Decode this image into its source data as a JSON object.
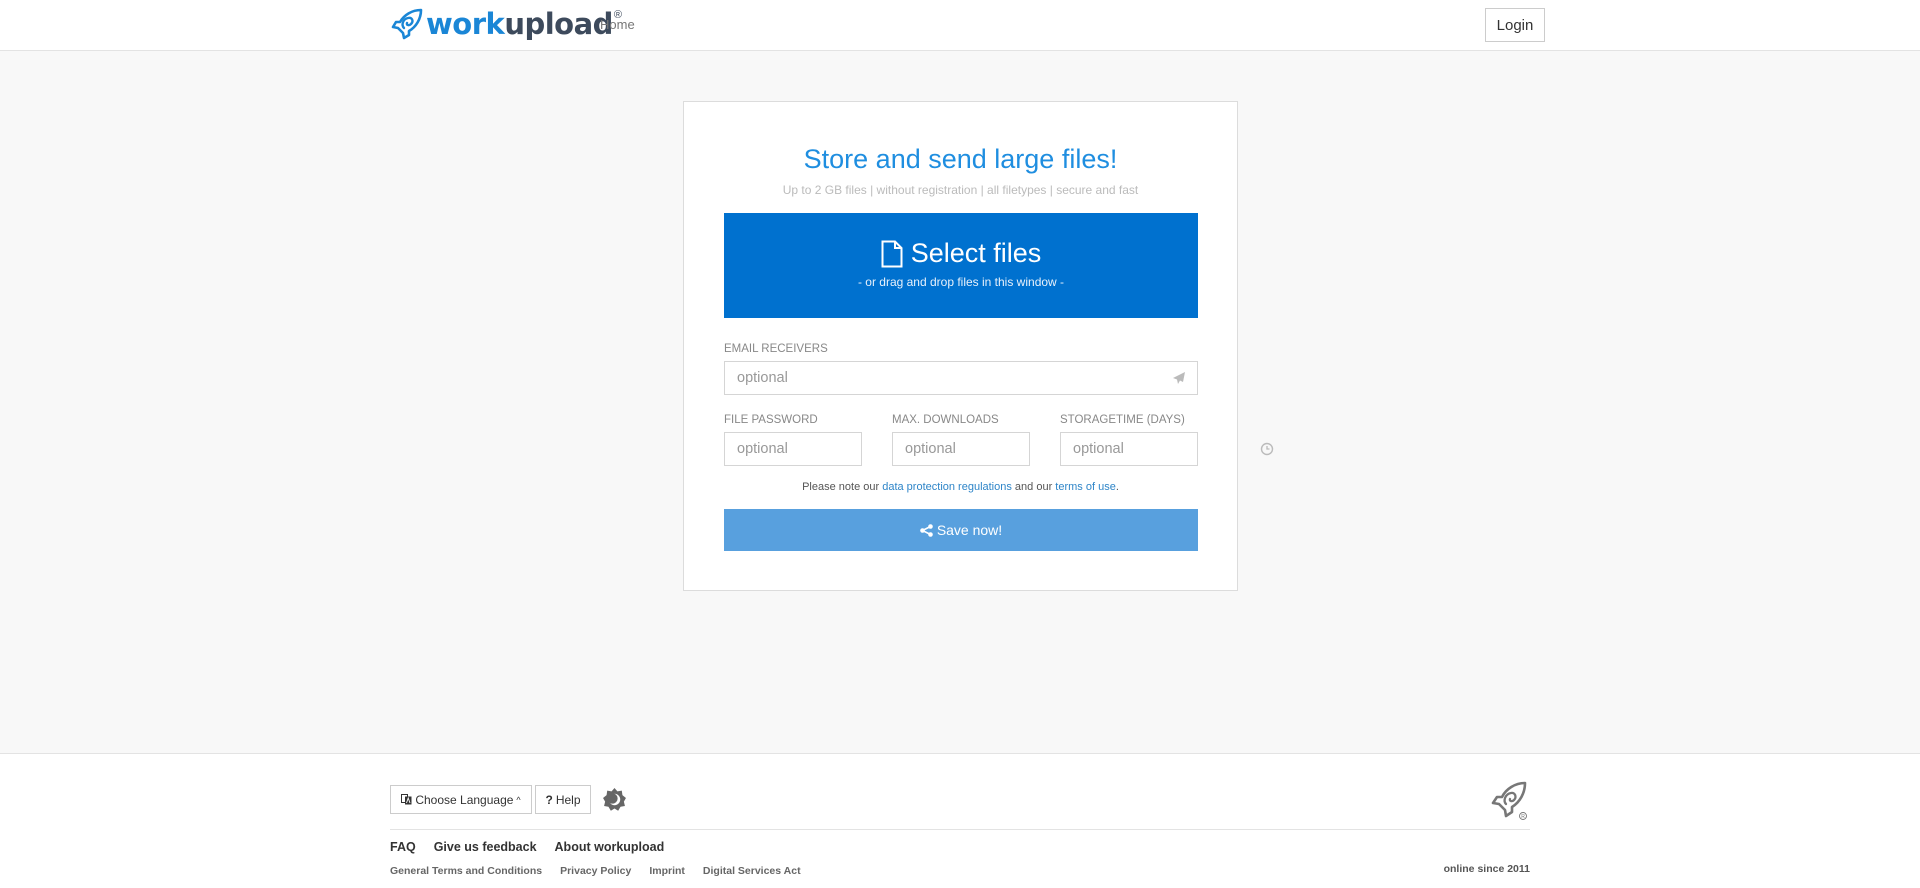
{
  "header": {
    "logo": {
      "part1": "work",
      "part2": "upload",
      "registered": "®"
    },
    "nav": [
      {
        "label": "Home"
      }
    ],
    "login_label": "Login"
  },
  "main": {
    "title": "Store and send large files!",
    "subtitle": "Up to 2 GB files | without registration | all filetypes | secure and fast",
    "select_files": {
      "label": "Select files",
      "sublabel": "- or drag and drop files in this window -",
      "icon": "file-icon"
    },
    "fields": {
      "email": {
        "label": "EMAIL RECEIVERS",
        "placeholder": "optional",
        "value": "",
        "icon": "paper-plane-icon"
      },
      "password": {
        "label": "FILE PASSWORD",
        "placeholder": "optional",
        "value": "",
        "icon": "lock-icon"
      },
      "downloads": {
        "label": "MAX. DOWNLOADS",
        "placeholder": "optional",
        "value": "",
        "icon": "download-icon"
      },
      "storagetime": {
        "label": "STORAGETIME (DAYS)",
        "placeholder": "optional",
        "value": "",
        "icon": "clock-icon"
      }
    },
    "note": {
      "prefix": "Please note our ",
      "link1": "data protection regulations",
      "middle": " and our ",
      "link2": "terms of use",
      "suffix": "."
    },
    "save_label": "Save now!"
  },
  "footer": {
    "language_label": "Choose Language",
    "help_label": "Help",
    "help_prefix": "?",
    "main_links": [
      {
        "label": "FAQ"
      },
      {
        "label": "Give us feedback"
      },
      {
        "label": "About workupload"
      }
    ],
    "legal_links": [
      {
        "label": "General Terms and Conditions"
      },
      {
        "label": "Privacy Policy"
      },
      {
        "label": "Imprint"
      },
      {
        "label": "Digital Services Act"
      }
    ],
    "online_since": "online since 2011"
  },
  "colors": {
    "brand_blue": "#1a86d6",
    "select_box": "#0071cf",
    "save_button": "#58a0de",
    "link": "#2e85c8"
  }
}
